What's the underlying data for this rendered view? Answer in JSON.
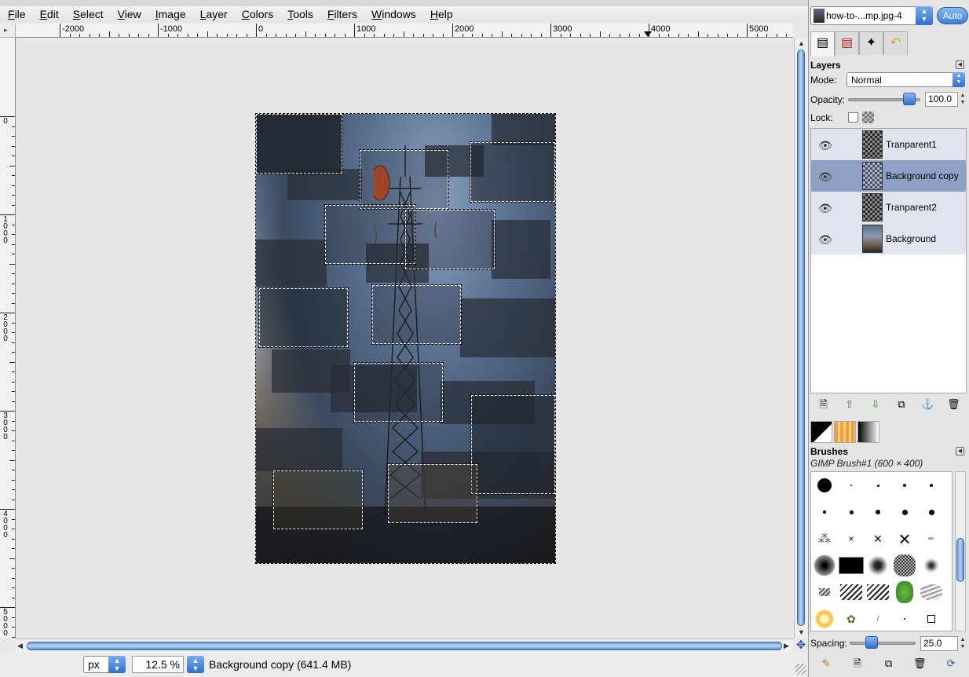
{
  "menubar": {
    "items": [
      "File",
      "Edit",
      "Select",
      "View",
      "Image",
      "Layer",
      "Colors",
      "Tools",
      "Filters",
      "Windows",
      "Help"
    ]
  },
  "rulers": {
    "horizontal_labels": [
      "-2000",
      "-1000",
      "0",
      "1000",
      "2000",
      "3000",
      "4000",
      "5000"
    ],
    "vertical_labels": [
      "0",
      "1\n0\n0\n0",
      "2\n0\n0\n0",
      "3\n0\n0\n0",
      "4\n0\n0\n0",
      "5\n0\n0\n0"
    ]
  },
  "statusbar": {
    "unit": "px",
    "zoom": "12.5 %",
    "message": "Background copy (641.4 MB)"
  },
  "dock": {
    "image_selector": "how-to-...mp.jpg-4",
    "auto_label": "Auto",
    "layers": {
      "title": "Layers",
      "mode_label": "Mode:",
      "mode_value": "Normal",
      "opacity_label": "Opacity:",
      "opacity_value": "100.0",
      "opacity_fraction": 1.0,
      "lock_label": "Lock:",
      "items": [
        {
          "name": "Tranparent1",
          "thumb": "checker",
          "selected": false
        },
        {
          "name": "Background copy",
          "thumb": "copy",
          "selected": true
        },
        {
          "name": "Tranparent2",
          "thumb": "checker",
          "selected": false
        },
        {
          "name": "Background",
          "thumb": "photo",
          "selected": false
        }
      ]
    },
    "brushes": {
      "title": "Brushes",
      "current": "GIMP Brush#1 (600 × 400)",
      "spacing_label": "Spacing:",
      "spacing_value": "25.0"
    }
  },
  "colors": {
    "accent": "#3e7ed6",
    "selected_layer": "#8ea0c4"
  }
}
